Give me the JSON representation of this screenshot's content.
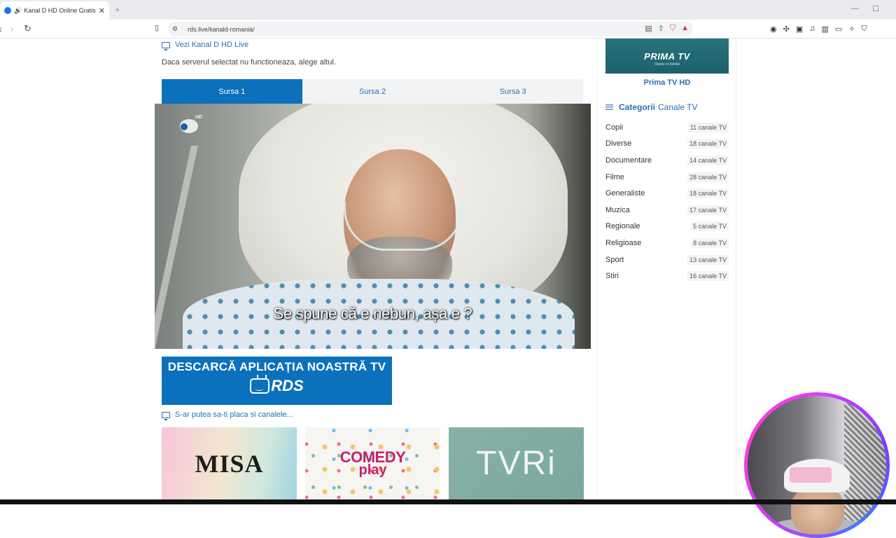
{
  "browser": {
    "tab_title": "Kanal D HD Online Gratis - RDS",
    "tab_close": "✕",
    "new_tab": "+",
    "url": "rds.live/kanald-romania/",
    "minimize": "—",
    "maximize": "☐"
  },
  "page": {
    "watch_heading": "Vezi Kanal D HD Live",
    "server_note": "Daca serverul selectat nu functioneaza, alege altul.",
    "source_tabs": [
      "Sursa 1",
      "Sursa 2",
      "Sursa 3"
    ],
    "active_tab_index": 0,
    "player": {
      "channel_logo_hd": "HD",
      "subtitle": "Se spune că e nebun, așa e ?"
    },
    "banner": {
      "title": "DESCARCĂ APLICAȚIA NOASTRĂ TV",
      "brand": "RDS"
    },
    "may_like_heading": "S-ar putea sa-ti placa si canalele...",
    "thumbnails": [
      {
        "name": "MISA"
      },
      {
        "name_line1": "COMEDY",
        "name_line2": "play"
      },
      {
        "name": "TVRi"
      }
    ]
  },
  "sidebar": {
    "featured": {
      "logo_text": "PRIMA TV",
      "logo_sub": "Clipele în familie",
      "label": "Prima TV HD"
    },
    "categories_heading_bold": "Categorii",
    "categories_heading_rest": "Canale TV",
    "categories": [
      {
        "name": "Copii",
        "count": "11 canale TV"
      },
      {
        "name": "Diverse",
        "count": "18 canale TV"
      },
      {
        "name": "Documentare",
        "count": "14 canale TV"
      },
      {
        "name": "Filme",
        "count": "28 canale TV"
      },
      {
        "name": "Generaliste",
        "count": "18 canale TV"
      },
      {
        "name": "Muzica",
        "count": "17 canale TV"
      },
      {
        "name": "Regionale",
        "count": "5 canale TV"
      },
      {
        "name": "Religioase",
        "count": "8 canale TV"
      },
      {
        "name": "Sport",
        "count": "13 canale TV"
      },
      {
        "name": "Stiri",
        "count": "16 canale TV"
      }
    ]
  },
  "colors": {
    "accent": "#0b71bc",
    "link": "#2a6fb3"
  }
}
